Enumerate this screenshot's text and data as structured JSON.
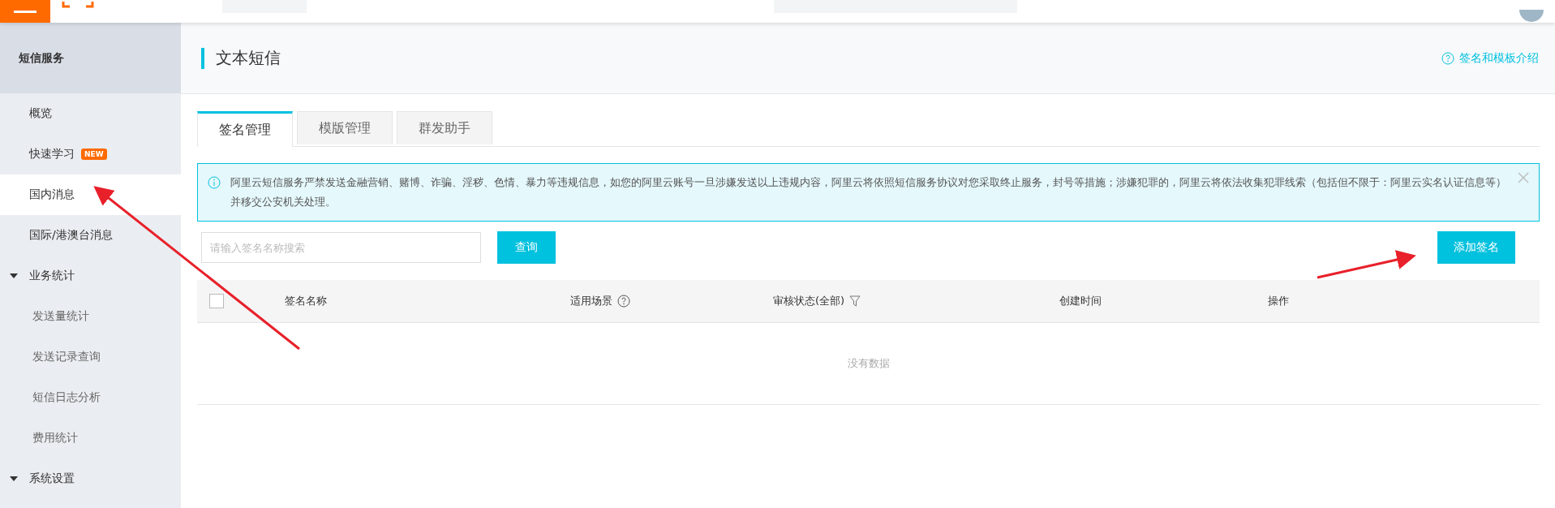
{
  "sidebar": {
    "title": "短信服务",
    "items": [
      {
        "label": "概览",
        "kind": "item",
        "selected": false
      },
      {
        "label": "快速学习",
        "kind": "item",
        "selected": false,
        "badge": "NEW"
      },
      {
        "label": "国内消息",
        "kind": "item",
        "selected": true
      },
      {
        "label": "国际/港澳台消息",
        "kind": "item",
        "selected": false
      },
      {
        "label": "业务统计",
        "kind": "group",
        "expanded": true,
        "children": [
          {
            "label": "发送量统计",
            "selected": false
          },
          {
            "label": "发送记录查询",
            "selected": false
          },
          {
            "label": "短信日志分析",
            "selected": false
          },
          {
            "label": "费用统计",
            "selected": false
          }
        ]
      },
      {
        "label": "系统设置",
        "kind": "group",
        "expanded": true
      }
    ]
  },
  "header": {
    "title": "文本短信",
    "help_link": "签名和模板介绍"
  },
  "tabs": [
    {
      "label": "签名管理",
      "selected": true
    },
    {
      "label": "模版管理",
      "selected": false
    },
    {
      "label": "群发助手",
      "selected": false
    }
  ],
  "alert": {
    "text": "阿里云短信服务严禁发送金融营销、赌博、诈骗、淫秽、色情、暴力等违规信息，如您的阿里云账号一旦涉嫌发送以上违规内容，阿里云将依照短信服务协议对您采取终止服务，封号等措施；涉嫌犯罪的，阿里云将依法收集犯罪线索（包括但不限于：阿里云实名认证信息等）并移交公安机关处理。"
  },
  "search": {
    "placeholder": "请输入签名名称搜索",
    "button": "查询"
  },
  "add_button": "添加签名",
  "table": {
    "select_all_checked": false,
    "columns": [
      {
        "label": "签名名称",
        "kind": "plain"
      },
      {
        "label": "适用场景",
        "kind": "help"
      },
      {
        "label": "审核状态(全部)",
        "kind": "filter"
      },
      {
        "label": "创建时间",
        "kind": "plain"
      },
      {
        "label": "操作",
        "kind": "plain"
      }
    ],
    "empty_text": "没有数据"
  }
}
